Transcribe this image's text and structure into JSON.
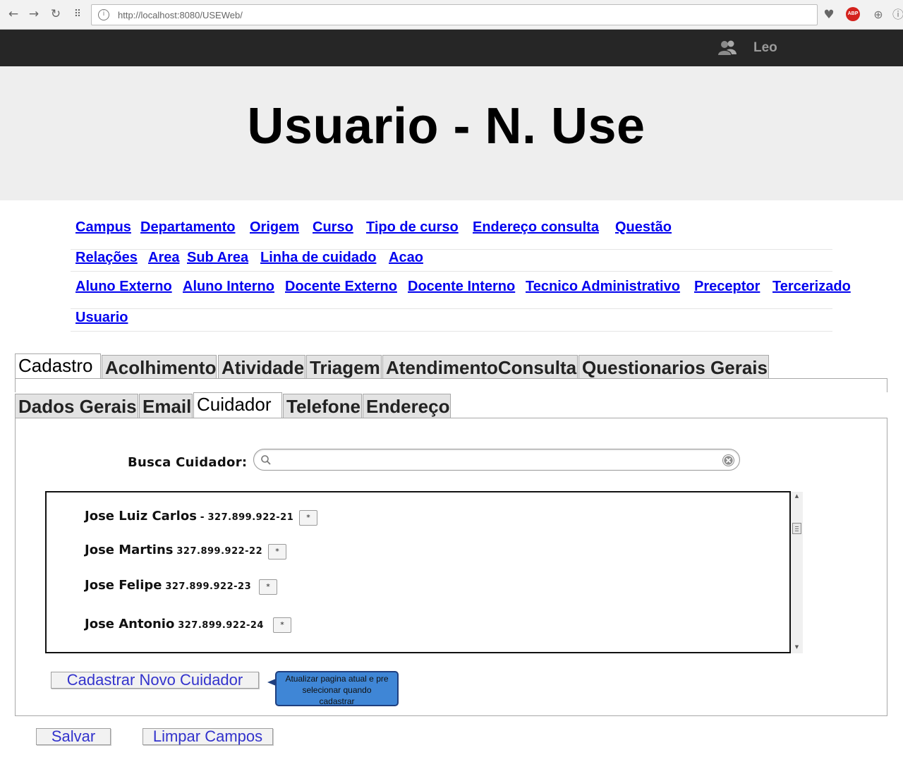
{
  "browser": {
    "url": "http://localhost:8080/USEWeb/",
    "icons": [
      "back-icon",
      "forward-icon",
      "reload-icon",
      "apps-icon",
      "heart-icon",
      "adblock-icon",
      "download-icon",
      "info-icon"
    ],
    "adblock_label": "ABP"
  },
  "topbar": {
    "user_name": "Leo",
    "background": "#262626"
  },
  "hero": {
    "title": "Usuario - N. Use"
  },
  "nav": {
    "rows": [
      [
        "Campus",
        "Departamento",
        "Origem",
        "Curso",
        "Tipo de curso",
        "Endereço consulta",
        "Questão"
      ],
      [
        "Relações",
        "Area",
        "Sub Area",
        "Linha de cuidado",
        "Acao"
      ],
      [
        "Aluno Externo",
        "Aluno Interno",
        "Docente Externo",
        "Docente Interno",
        "Tecnico Administrativo",
        "Preceptor",
        "Tercerizado"
      ],
      [
        "Usuario"
      ]
    ],
    "link_color": "#0000ee"
  },
  "main_tabs": {
    "items": [
      "Cadastro",
      "Acolhimento",
      "Atividade",
      "Triagem",
      "AtendimentoConsulta",
      "Questionarios Gerais"
    ],
    "active": "Cadastro"
  },
  "sub_tabs": {
    "items": [
      "Dados Gerais",
      "Email",
      "Cuidador",
      "Telefone",
      "Endereço"
    ],
    "active": "Cuidador"
  },
  "search": {
    "label": "Busca Cuidador:",
    "value": "",
    "placeholder": ""
  },
  "cuidadores": [
    {
      "name": "Jose Luiz Carlos",
      "separator": " - ",
      "cpf": "327.899.922-21",
      "button": "*"
    },
    {
      "name": "Jose Martins",
      "separator": " ",
      "cpf": "327.899.922-22",
      "button": "*"
    },
    {
      "name": "Jose Felipe",
      "separator": " ",
      "cpf": "327.899.922-23",
      "button": "*"
    },
    {
      "name": "Jose Antonio",
      "separator": " ",
      "cpf": "327.899.922-24",
      "button": "*"
    }
  ],
  "actions": {
    "new_caregiver": "Cadastrar Novo Cuidador",
    "save": "Salvar",
    "clear": "Limpar Campos"
  },
  "tooltip": {
    "lines": [
      "Atualizar pagina atual e pre",
      "selecionar quando",
      "cadastrar"
    ],
    "color": "#3f86d6"
  }
}
